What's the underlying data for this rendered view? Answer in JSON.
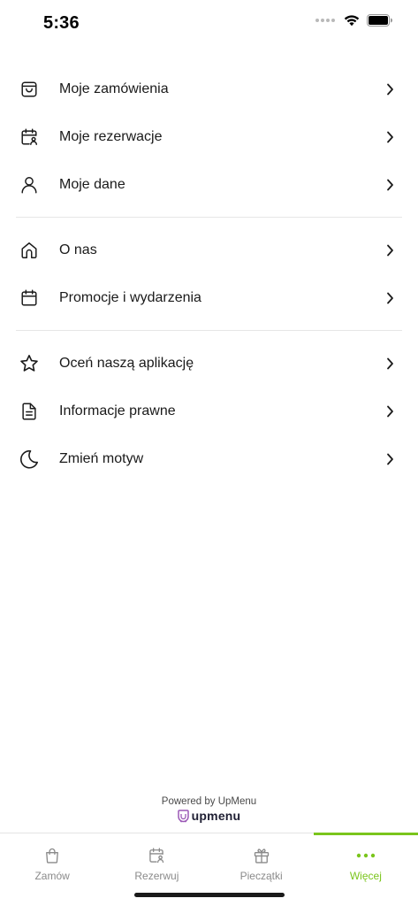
{
  "status_bar": {
    "time": "5:36"
  },
  "menu": {
    "groups": [
      {
        "items": [
          {
            "label": "Moje zamówienia",
            "icon": "shopping-bag-icon"
          },
          {
            "label": "Moje rezerwacje",
            "icon": "calendar-person-icon"
          },
          {
            "label": "Moje dane",
            "icon": "user-icon"
          }
        ]
      },
      {
        "items": [
          {
            "label": "O nas",
            "icon": "home-icon"
          },
          {
            "label": "Promocje i wydarzenia",
            "icon": "calendar-icon"
          }
        ]
      },
      {
        "items": [
          {
            "label": "Oceń naszą aplikację",
            "icon": "star-icon"
          },
          {
            "label": "Informacje prawne",
            "icon": "document-icon"
          },
          {
            "label": "Zmień motyw",
            "icon": "moon-icon"
          }
        ]
      }
    ]
  },
  "footer": {
    "powered_by": "Powered by UpMenu",
    "brand": "upmenu"
  },
  "tabbar": {
    "tabs": [
      {
        "label": "Zamów",
        "icon": "shopping-bag-icon"
      },
      {
        "label": "Rezerwuj",
        "icon": "calendar-person-icon"
      },
      {
        "label": "Pieczątki",
        "icon": "gift-icon"
      },
      {
        "label": "Więcej",
        "icon": "more-dots-icon"
      }
    ],
    "active_index": 3
  },
  "colors": {
    "accent": "#7ac51c",
    "text": "#1a1a1a",
    "muted": "#8a8a8a",
    "brand": "#9b59b6"
  }
}
